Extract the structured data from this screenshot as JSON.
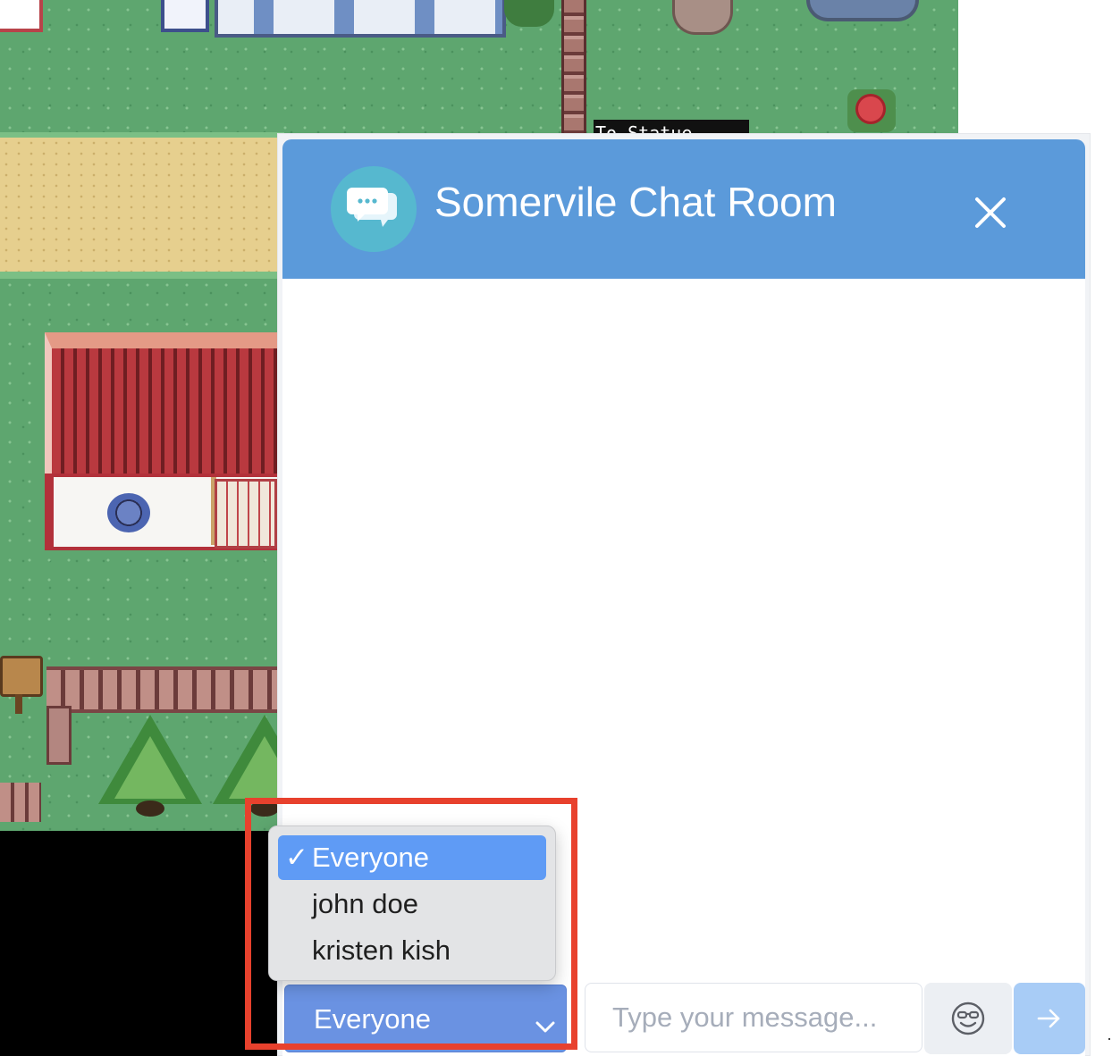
{
  "map": {
    "sign_text": "To Statue"
  },
  "chat": {
    "title": "Somervile Chat Room",
    "header_color": "#5b9ada",
    "avatar_icon": "chat-bubbles-icon",
    "close_icon": "close-icon"
  },
  "recipient": {
    "selected": "Everyone",
    "options": [
      {
        "label": "Everyone",
        "selected": true
      },
      {
        "label": "john doe",
        "selected": false
      },
      {
        "label": "kristen kish",
        "selected": false
      }
    ],
    "check_mark": "✓"
  },
  "composer": {
    "placeholder": "Type your message...",
    "value": "",
    "emoji_icon": "smiley-sunglasses-icon",
    "send_icon": "arrow-right-icon"
  },
  "annotation": {
    "highlight_color": "#e8412d"
  }
}
